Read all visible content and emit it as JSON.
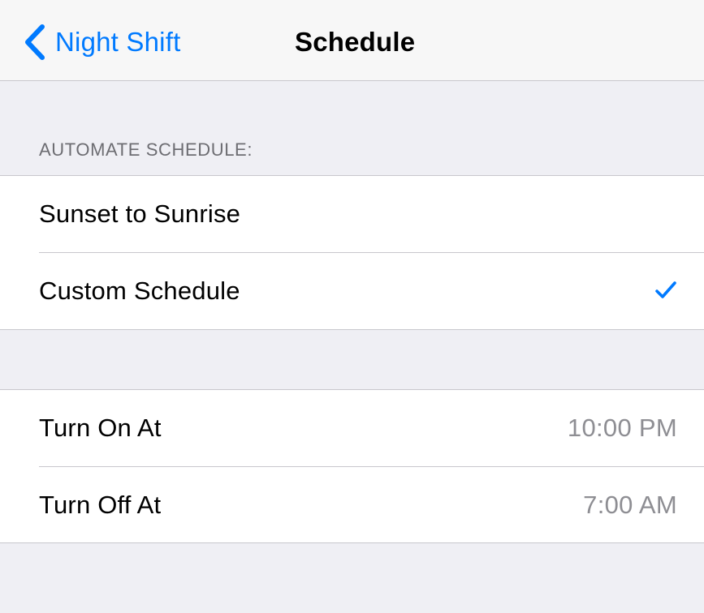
{
  "navbar": {
    "back_label": "Night Shift",
    "title": "Schedule"
  },
  "automate_section": {
    "header": "AUTOMATE SCHEDULE:",
    "options": [
      {
        "label": "Sunset to Sunrise",
        "selected": false
      },
      {
        "label": "Custom Schedule",
        "selected": true
      }
    ]
  },
  "times_section": {
    "rows": [
      {
        "label": "Turn On At",
        "value": "10:00 PM"
      },
      {
        "label": "Turn Off At",
        "value": "7:00 AM"
      }
    ]
  },
  "colors": {
    "accent": "#007aff",
    "background": "#efeff4",
    "secondary_text": "#8e8e93",
    "separator": "#c8c7cc"
  },
  "icons": {
    "back": "chevron-left-icon",
    "selected": "checkmark-icon"
  }
}
